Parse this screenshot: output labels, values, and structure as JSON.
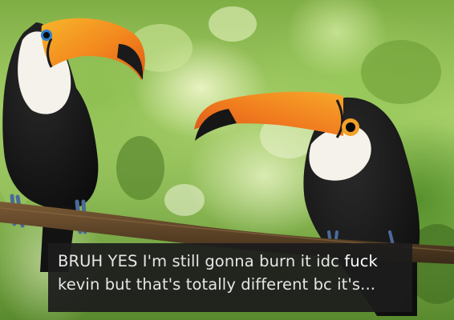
{
  "caption": {
    "line1_before": "BRUH YES I'm still gonna burn it idc ",
    "line1_emphasis": "fuck",
    "line2": "kevin but that's totally different bc it's..."
  },
  "scene": {
    "subject": "two-toucans-on-branch",
    "colors": {
      "beak_orange": "#f07a1e",
      "beak_yellow": "#f7b52a",
      "plumage_black": "#141414",
      "throat_white": "#f4f2ea",
      "branch_brown": "#5b4226",
      "foliage_green": "#8dbb55"
    }
  }
}
